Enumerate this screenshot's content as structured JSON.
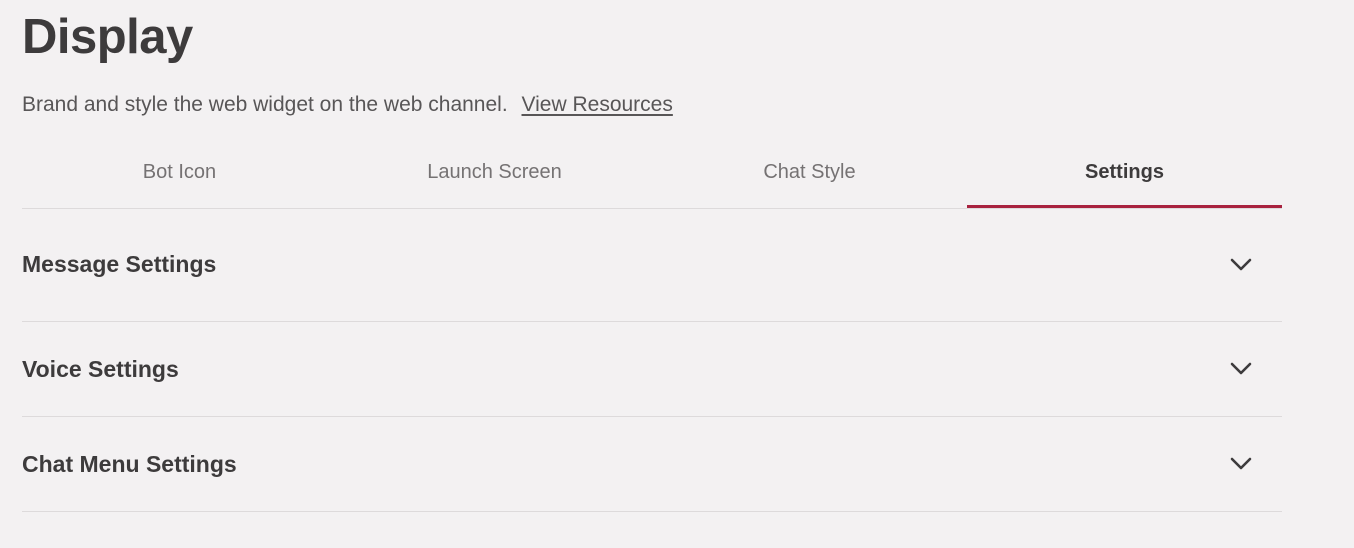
{
  "header": {
    "title": "Display",
    "subtitle": "Brand and style the web widget on the web channel.",
    "link_label": "View Resources"
  },
  "tabs": [
    {
      "label": "Bot Icon",
      "active": false
    },
    {
      "label": "Launch Screen",
      "active": false
    },
    {
      "label": "Chat Style",
      "active": false
    },
    {
      "label": "Settings",
      "active": true
    }
  ],
  "accordion": {
    "items": [
      {
        "title": "Message Settings",
        "icon": "chevron-down-icon"
      },
      {
        "title": "Voice Settings",
        "icon": "chevron-down-icon"
      },
      {
        "title": "Chat Menu Settings",
        "icon": "chevron-down-icon"
      }
    ]
  },
  "colors": {
    "background": "#f3f1f2",
    "text": "#3d3b3c",
    "accent": "#a8223f",
    "divider": "#dddadb"
  }
}
